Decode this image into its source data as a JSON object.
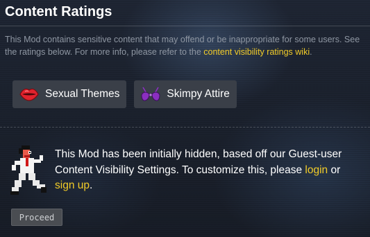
{
  "section": {
    "title": "Content Ratings",
    "description_before": "This Mod contains sensitive content that may offend or be inappropriate for some users. See the ratings below. For more info, please refer to the ",
    "description_link": "content visibility ratings wiki",
    "description_after": "."
  },
  "ratings": [
    {
      "label": "Sexual Themes",
      "icon": "lips-icon"
    },
    {
      "label": "Skimpy Attire",
      "icon": "bikini-top-icon"
    }
  ],
  "notice": {
    "text_before": "This Mod has been initially hidden, based off our Guest-user Content Visibility Settings. To customize this, please ",
    "login": "login",
    "text_middle": " or ",
    "signup": "sign up",
    "text_after": "."
  },
  "proceed_label": "Proceed",
  "colors": {
    "link": "#f2cc28",
    "badge_bg": "#3a3f48",
    "lips": "#e1232d",
    "bikini": "#8a2fc0",
    "button_bg": "#4a4d52"
  }
}
